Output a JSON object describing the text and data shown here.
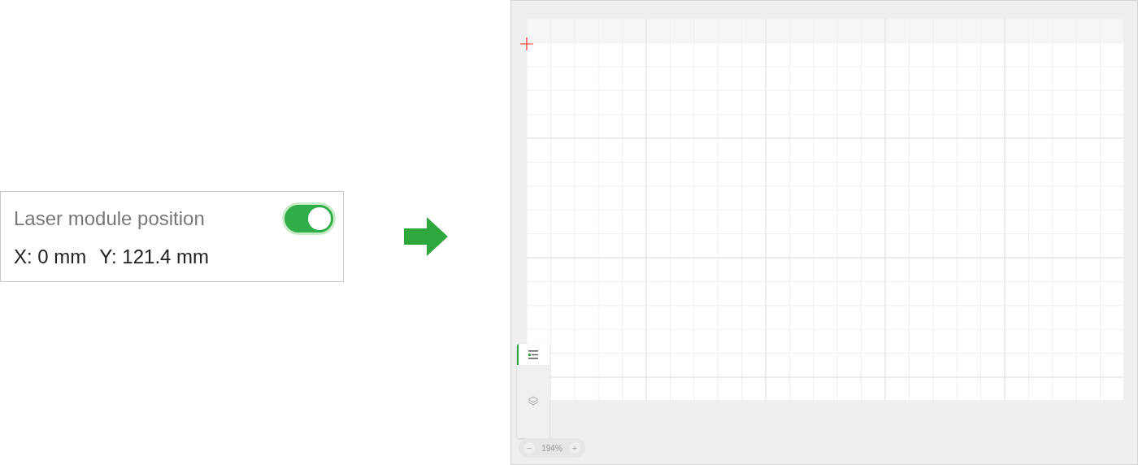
{
  "position_panel": {
    "label": "Laser module position",
    "on": true,
    "x_reading": "X: 0 mm",
    "y_reading": "Y: 121.4 mm"
  },
  "workspace": {
    "tools": [
      {
        "kind": "objects",
        "selected": true
      },
      {
        "kind": "layers",
        "selected": false
      }
    ],
    "zoom": {
      "decrease": "−",
      "value": "194%",
      "increase": "+"
    }
  }
}
